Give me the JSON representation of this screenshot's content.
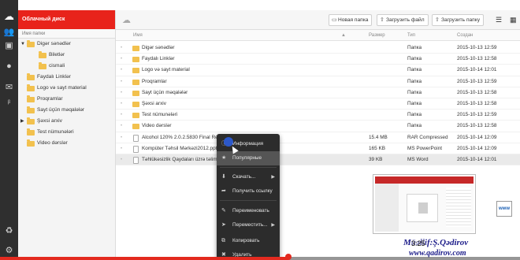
{
  "rail": {
    "icons": [
      "cloud-logo-icon",
      "users-icon",
      "user-card-icon",
      "chat-icon",
      "beta-icon",
      "recycle-icon",
      "settings-icon"
    ]
  },
  "sidebar": {
    "title": "Облачный диск",
    "column_header": "Имя папки",
    "items": [
      {
        "label": "Digər sənədlər",
        "level": 0,
        "arrow": "▼"
      },
      {
        "label": "Biletlər",
        "level": 1,
        "arrow": ""
      },
      {
        "label": "cismali",
        "level": 1,
        "arrow": ""
      },
      {
        "label": "Faydalı Linklər",
        "level": 0,
        "arrow": ""
      },
      {
        "label": "Logo və sayt material",
        "level": 0,
        "arrow": ""
      },
      {
        "label": "Proqramlar",
        "level": 0,
        "arrow": ""
      },
      {
        "label": "Sayt üçün məqalələr",
        "level": 0,
        "arrow": ""
      },
      {
        "label": "Şəxsi arxiv",
        "level": 0,
        "arrow": "▶"
      },
      {
        "label": "Test nümunələri",
        "level": 0,
        "arrow": ""
      },
      {
        "label": "Video dərslər",
        "level": 0,
        "arrow": ""
      }
    ]
  },
  "toolbar": {
    "new_folder": "Новая папка",
    "upload_file": "Загрузить файл",
    "upload_folder": "Загрузить папку"
  },
  "table": {
    "columns": {
      "name": "Имя",
      "size": "Размер",
      "type": "Тип",
      "created": "Создан"
    },
    "rows": [
      {
        "name": "Digər sənədlər",
        "size": "",
        "type": "Папка",
        "created": "2015-10-13 12:59",
        "kind": "folder"
      },
      {
        "name": "Faydalı Linklər",
        "size": "",
        "type": "Папка",
        "created": "2015-10-13 12:58",
        "kind": "folder"
      },
      {
        "name": "Logo və sayt material",
        "size": "",
        "type": "Папка",
        "created": "2015-10-14 12:01",
        "kind": "folder"
      },
      {
        "name": "Proqramlar",
        "size": "",
        "type": "Папка",
        "created": "2015-10-13 12:59",
        "kind": "folder"
      },
      {
        "name": "Sayt üçün məqalələr",
        "size": "",
        "type": "Папка",
        "created": "2015-10-13 12:58",
        "kind": "folder"
      },
      {
        "name": "Şəxsi arxiv",
        "size": "",
        "type": "Папка",
        "created": "2015-10-13 12:58",
        "kind": "folder"
      },
      {
        "name": "Test nümunələri",
        "size": "",
        "type": "Папка",
        "created": "2015-10-13 12:59",
        "kind": "folder"
      },
      {
        "name": "Video dərslər",
        "size": "",
        "type": "Папка",
        "created": "2015-10-13 12:58",
        "kind": "folder"
      },
      {
        "name": "Alcohol 120% 2.0.2.5830 Final Retail",
        "size": "15.4 MB",
        "type": "RAR Compressed",
        "created": "2015-10-14 12:09",
        "kind": "file"
      },
      {
        "name": "Kompüter Təhsil Mərkəzi2012.pptx",
        "size": "165 KB",
        "type": "MS PowerPoint",
        "created": "2015-10-14 12:09",
        "kind": "file"
      },
      {
        "name": "Təhlükəsizlik Qaydaları üzrə təlimat v",
        "size": "39 KB",
        "type": "MS Word",
        "created": "2015-10-14 12:01",
        "kind": "file"
      }
    ]
  },
  "context_menu": {
    "items": [
      {
        "label": "Информация",
        "icon": "info-icon",
        "submenu": false
      },
      {
        "label": "Популярные",
        "icon": "star-icon",
        "submenu": false
      },
      {
        "label": "Скачать...",
        "icon": "download-icon",
        "submenu": true
      },
      {
        "label": "Получить ссылку",
        "icon": "share-link-icon",
        "submenu": false
      },
      {
        "label": "Переименовать",
        "icon": "rename-icon",
        "submenu": false
      },
      {
        "label": "Переместить...",
        "icon": "move-icon",
        "submenu": true
      },
      {
        "label": "Копировать",
        "icon": "copy-icon",
        "submenu": false
      },
      {
        "label": "Удалить",
        "icon": "delete-icon",
        "submenu": false
      }
    ]
  },
  "overlay": {
    "author": "Müəllif:Ş.Qədirov",
    "site": "www.qadirov.com",
    "time": "3:25",
    "logo": "www"
  },
  "video": {
    "progress_fraction": 0.555
  },
  "colors": {
    "accent": "#e8231b",
    "rail": "#2f2f2f",
    "menu": "#2c2c2c",
    "credit": "#1d1d8a"
  }
}
